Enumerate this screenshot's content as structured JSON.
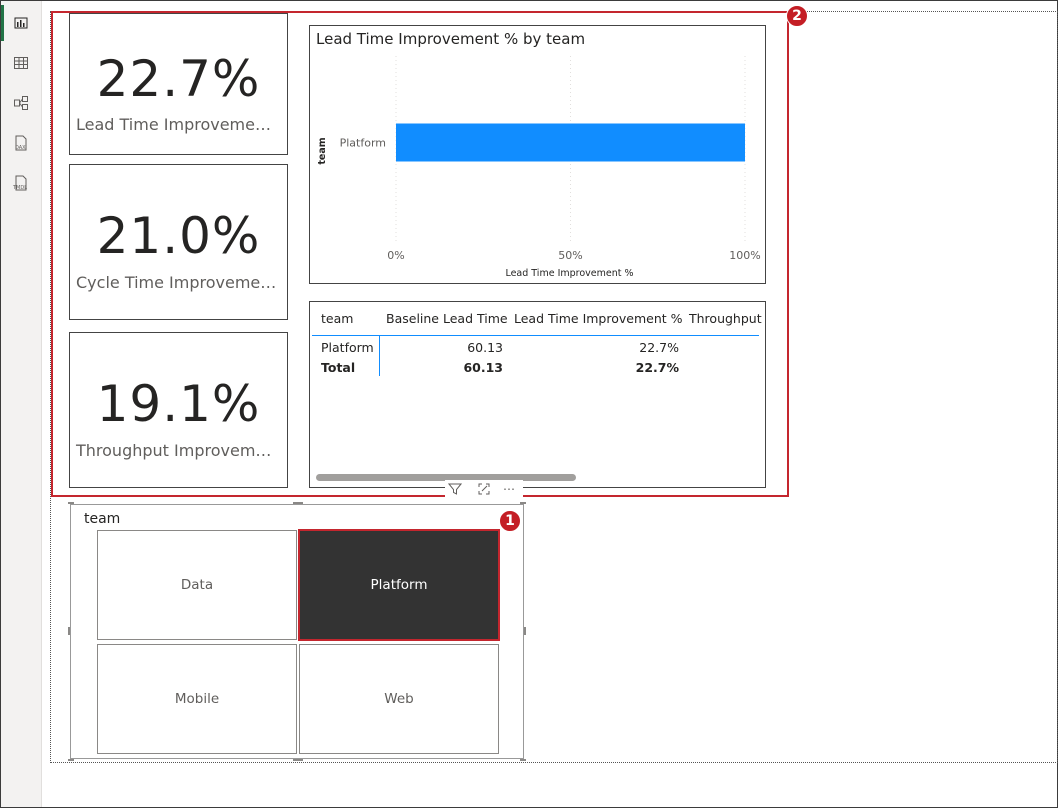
{
  "left_rail": {
    "items": [
      {
        "name": "report-view-icon",
        "active": true
      },
      {
        "name": "table-view-icon",
        "active": false
      },
      {
        "name": "model-view-icon",
        "active": false
      },
      {
        "name": "dax-query-view-icon",
        "active": false,
        "label": "DAX"
      },
      {
        "name": "tmdl-view-icon",
        "active": false,
        "label": "TMDL"
      }
    ]
  },
  "cards": [
    {
      "value": "22.7%",
      "label": "Lead Time Improvement %"
    },
    {
      "value": "21.0%",
      "label": "Cycle Time Improvement %"
    },
    {
      "value": "19.1%",
      "label": "Throughput Improvement..."
    }
  ],
  "badges": {
    "group": "2",
    "slicer": "1"
  },
  "chart_data": {
    "type": "bar",
    "title": "Lead Time Improvement % by team",
    "categories": [
      "Platform"
    ],
    "values": [
      100
    ],
    "xlabel": "Lead Time Improvement %",
    "ylabel": "team",
    "xlim": [
      0,
      100
    ],
    "x_ticks": [
      "0%",
      "50%",
      "100%"
    ],
    "bar_color": "#118DFF",
    "grid": true
  },
  "table": {
    "headers": [
      "team",
      "Baseline Lead Time",
      "Lead Time Improvement %",
      "Throughput"
    ],
    "rows": [
      [
        "Platform",
        "60.13",
        "22.7%"
      ]
    ],
    "total": [
      "Total",
      "60.13",
      "22.7%"
    ]
  },
  "slicer": {
    "title": "team",
    "options": [
      "Data",
      "Platform",
      "Mobile",
      "Web"
    ],
    "selected": "Platform"
  },
  "colors": {
    "accent_red": "#C4262E",
    "bar_blue": "#118DFF",
    "selected_tile": "#333333"
  }
}
